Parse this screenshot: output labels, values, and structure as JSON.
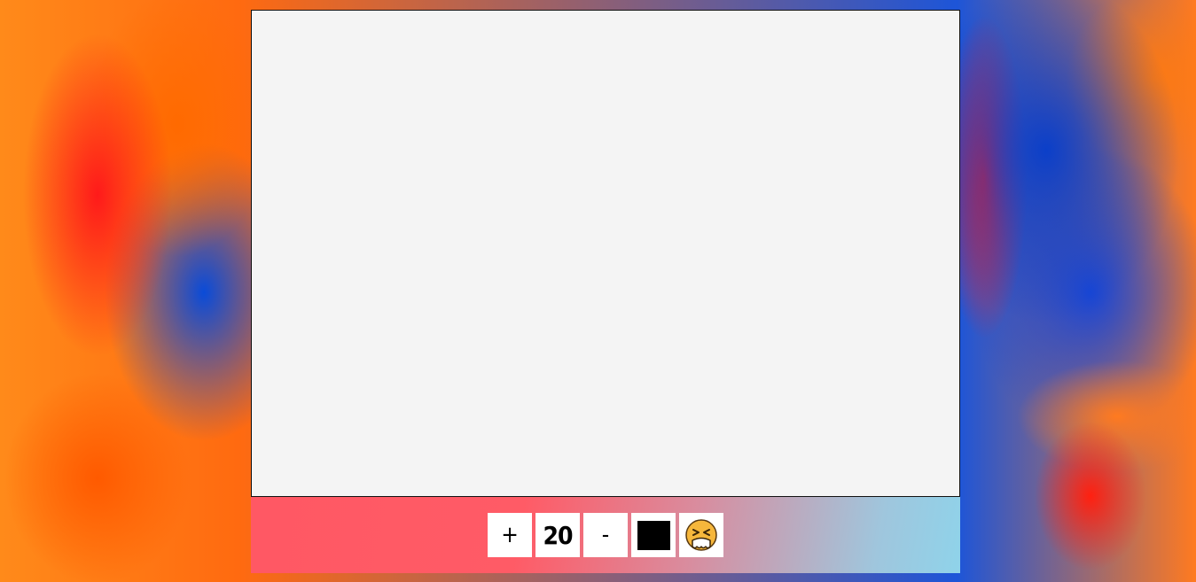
{
  "toolbar": {
    "increase_label": "+",
    "size_value": "20",
    "decrease_label": "-",
    "color_value": "#000000",
    "clear_icon": "face-with-tightly-closed-eyes-icon"
  },
  "colors": {
    "canvas_background": "#f4f4f4",
    "toolbar_gradient_start": "#ff5864",
    "toolbar_gradient_end": "#8fd3ea"
  }
}
